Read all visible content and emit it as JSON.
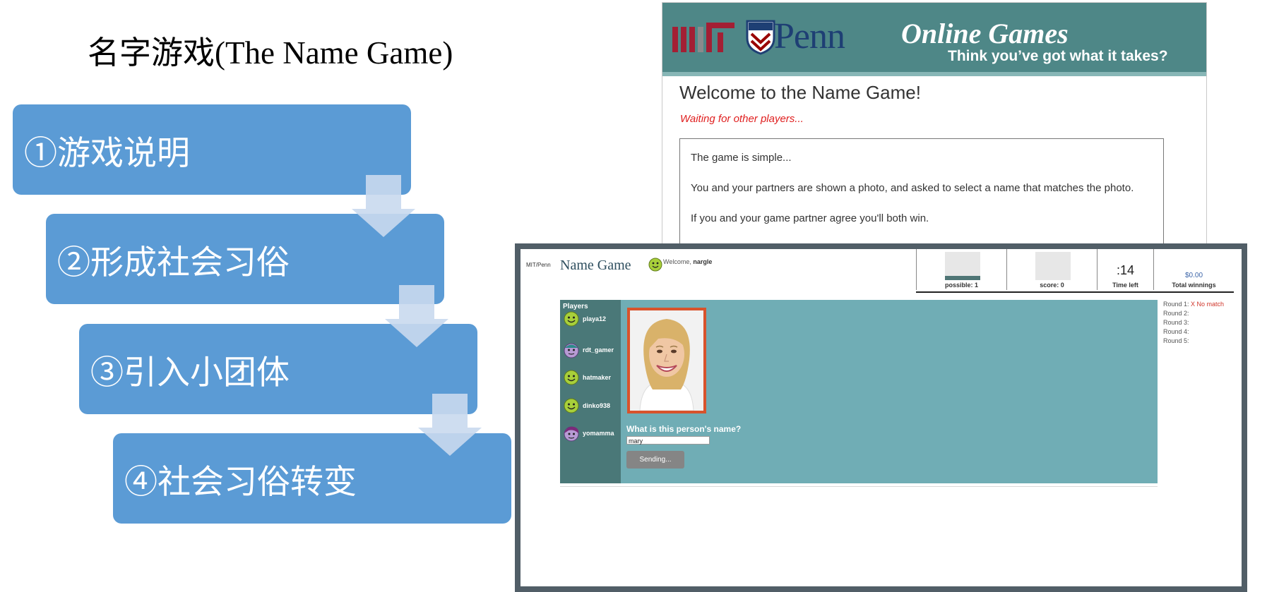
{
  "slide": {
    "title": "名字游戏(The Name Game)",
    "steps": [
      "①游戏说明",
      "②形成社会习俗",
      "③引入小团体",
      "④社会习俗转变"
    ]
  },
  "intro_screen": {
    "logo_mit": "MIT",
    "logo_penn": "Penn",
    "header_title": "Online Games",
    "header_subtitle": "Think you’ve got what it takes?",
    "welcome": "Welcome to the Name Game!",
    "status": "Waiting for other players...",
    "rules": [
      "The game is simple...",
      "You and your partners are shown a photo, and asked to select a name that matches the photo.",
      "If you and your game partner agree you'll both win."
    ]
  },
  "game_screen": {
    "logo": "MIT/Penn",
    "title": "Name Game",
    "welcome_prefix": "Welcome,",
    "username": "nargle",
    "stats": {
      "possible_label": "possible: 1",
      "score_label": "score: 0",
      "time_value": ":14",
      "time_label": "Time left",
      "winnings_value": "$0.00",
      "winnings_label": "Total winnings",
      "possible_fill": 0.15,
      "score_fill": 0.0
    },
    "players_header": "Players",
    "players": [
      {
        "name": "playa12",
        "icon": "green-smiley-icon"
      },
      {
        "name": "rdt_gamer",
        "icon": "purple-face-icon"
      },
      {
        "name": "hatmaker",
        "icon": "green-smiley-icon"
      },
      {
        "name": "dinko938",
        "icon": "green-smiley-icon"
      },
      {
        "name": "yomamma",
        "icon": "purple-hair-face-icon"
      }
    ],
    "question": "What is this person's name?",
    "answer_value": "mary",
    "button_label": "Sending...",
    "rounds": [
      {
        "label": "Round 1:",
        "result": "X No match"
      },
      {
        "label": "Round 2:",
        "result": ""
      },
      {
        "label": "Round 3:",
        "result": ""
      },
      {
        "label": "Round 4:",
        "result": ""
      },
      {
        "label": "Round 5:",
        "result": ""
      }
    ]
  },
  "colors": {
    "step_fill": "#5b9bd5",
    "arrow_fill": "#c9d9ee",
    "header_teal": "#4e8787",
    "game_teal": "#70adb5",
    "players_panel": "#4a7878",
    "frame": "#515e67",
    "photo_border": "#d8532c",
    "status_red": "#e02020"
  }
}
